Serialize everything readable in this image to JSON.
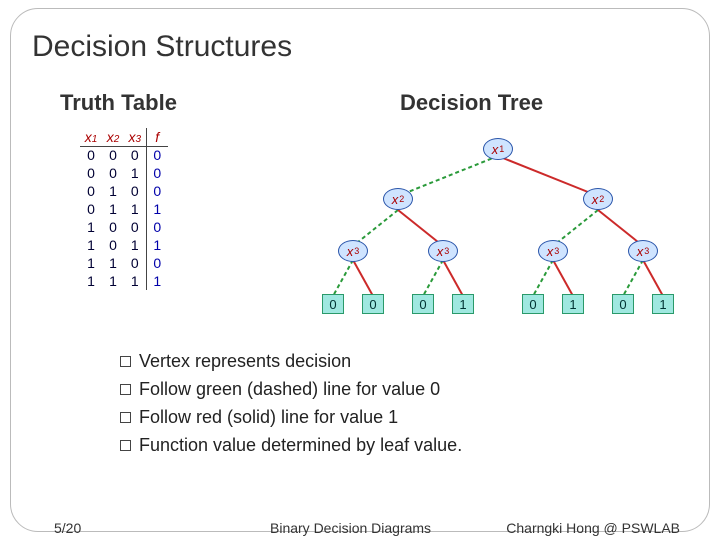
{
  "title": "Decision Structures",
  "subheads": {
    "left": "Truth Table",
    "right": "Decision Tree"
  },
  "truth_table": {
    "headers": [
      "x",
      "1",
      "x",
      "2",
      "x",
      "3",
      "f"
    ],
    "rows": [
      {
        "x1": "0",
        "x2": "0",
        "x3": "0",
        "f": "0"
      },
      {
        "x1": "0",
        "x2": "0",
        "x3": "1",
        "f": "0"
      },
      {
        "x1": "0",
        "x2": "1",
        "x3": "0",
        "f": "0"
      },
      {
        "x1": "0",
        "x2": "1",
        "x3": "1",
        "f": "1"
      },
      {
        "x1": "1",
        "x2": "0",
        "x3": "0",
        "f": "0"
      },
      {
        "x1": "1",
        "x2": "0",
        "x3": "1",
        "f": "1"
      },
      {
        "x1": "1",
        "x2": "1",
        "x3": "0",
        "f": "0"
      },
      {
        "x1": "1",
        "x2": "1",
        "x3": "1",
        "f": "1"
      }
    ]
  },
  "tree": {
    "root": "x1",
    "level2": [
      "x2",
      "x2"
    ],
    "level3": [
      "x3",
      "x3",
      "x3",
      "x3"
    ],
    "leaves": [
      "0",
      "0",
      "0",
      "1",
      "0",
      "1",
      "0",
      "1"
    ]
  },
  "bullets": [
    "Vertex represents decision",
    "Follow green (dashed) line for value 0",
    "Follow red (solid) line for value 1",
    "Function value determined by leaf value."
  ],
  "footer": {
    "page": "5/20",
    "center": "Binary Decision Diagrams",
    "right": "Charngki Hong @ PSWLAB"
  },
  "chart_data": {
    "type": "table",
    "title": "Truth table and corresponding binary decision tree for f(x1,x2,x3)",
    "series": [
      {
        "x1": 0,
        "x2": 0,
        "x3": 0,
        "f": 0
      },
      {
        "x1": 0,
        "x2": 0,
        "x3": 1,
        "f": 0
      },
      {
        "x1": 0,
        "x2": 1,
        "x3": 0,
        "f": 0
      },
      {
        "x1": 0,
        "x2": 1,
        "x3": 1,
        "f": 1
      },
      {
        "x1": 1,
        "x2": 0,
        "x3": 0,
        "f": 0
      },
      {
        "x1": 1,
        "x2": 0,
        "x3": 1,
        "f": 1
      },
      {
        "x1": 1,
        "x2": 1,
        "x3": 0,
        "f": 0
      },
      {
        "x1": 1,
        "x2": 1,
        "x3": 1,
        "f": 1
      }
    ],
    "edge_legend": {
      "0": "green dashed",
      "1": "red solid"
    }
  }
}
